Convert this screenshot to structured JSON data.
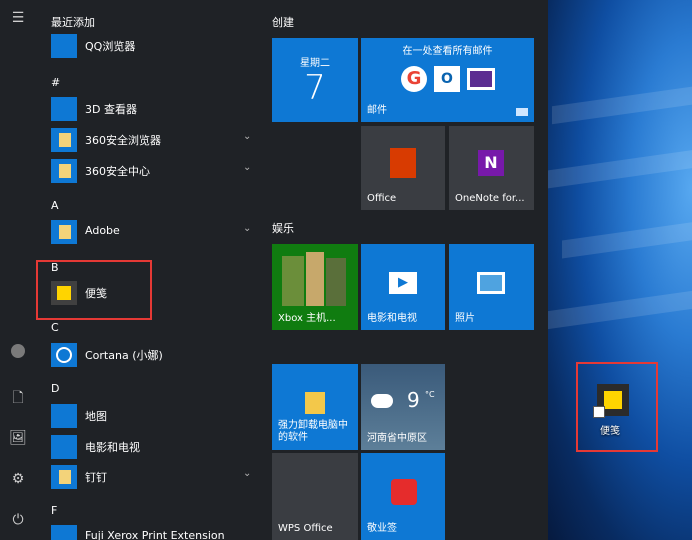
{
  "rail": {
    "icons": [
      "hamburger-icon",
      "user-icon",
      "document-icon",
      "pictures-icon",
      "settings-icon",
      "power-icon"
    ]
  },
  "applist": {
    "recent_header": "最近添加",
    "items": [
      {
        "type": "app",
        "label": "QQ浏览器",
        "icon": "qq-browser-icon",
        "color": "#0e78d4"
      },
      {
        "type": "header",
        "label": "#"
      },
      {
        "type": "app",
        "label": "3D 查看器",
        "icon": "cube-icon",
        "color": "#0e78d4"
      },
      {
        "type": "app",
        "label": "360安全浏览器",
        "icon": "folder-icon",
        "color": "#0e78d4",
        "chev": true
      },
      {
        "type": "app",
        "label": "360安全中心",
        "icon": "folder-icon",
        "color": "#0e78d4",
        "chev": true
      },
      {
        "type": "header",
        "label": "A"
      },
      {
        "type": "app",
        "label": "Adobe",
        "icon": "folder-icon",
        "color": "#0e78d4",
        "chev": true
      },
      {
        "type": "header",
        "label": "B"
      },
      {
        "type": "app",
        "label": "便笺",
        "icon": "sticky-notes-icon",
        "color": "#404040"
      },
      {
        "type": "header",
        "label": "C"
      },
      {
        "type": "app",
        "label": "Cortana (小娜)",
        "icon": "cortana-icon",
        "color": "#0e78d4"
      },
      {
        "type": "header",
        "label": "D"
      },
      {
        "type": "app",
        "label": "地图",
        "icon": "maps-icon",
        "color": "#0e78d4"
      },
      {
        "type": "app",
        "label": "电影和电视",
        "icon": "movies-icon",
        "color": "#0e78d4"
      },
      {
        "type": "app",
        "label": "钉钉",
        "icon": "folder-icon",
        "color": "#0e78d4",
        "chev": true
      },
      {
        "type": "header",
        "label": "F"
      },
      {
        "type": "app",
        "label": "Fuji Xerox Print Extension",
        "icon": "print-icon",
        "color": "#0e78d4"
      }
    ]
  },
  "tiles": {
    "group_create": "创建",
    "group_entertain": "娱乐",
    "calendar": {
      "weekday": "星期二",
      "day": "7"
    },
    "mail": {
      "title": "在一处查看所有邮件",
      "label": "邮件"
    },
    "office": {
      "label": "Office"
    },
    "onenote": {
      "label": "OneNote for..."
    },
    "xbox": {
      "label": "Xbox 主机..."
    },
    "movies": {
      "label": "电影和电视"
    },
    "photos": {
      "label": "照片"
    },
    "uninstall": {
      "label": "强力卸载电脑中的软件"
    },
    "weather": {
      "temp": "9",
      "unit": "°C",
      "city": "河南省中原区"
    },
    "wps": {
      "label": "WPS Office"
    },
    "sign": {
      "label": "敬业签"
    }
  },
  "desktop": {
    "shortcut_label": "便笺"
  }
}
